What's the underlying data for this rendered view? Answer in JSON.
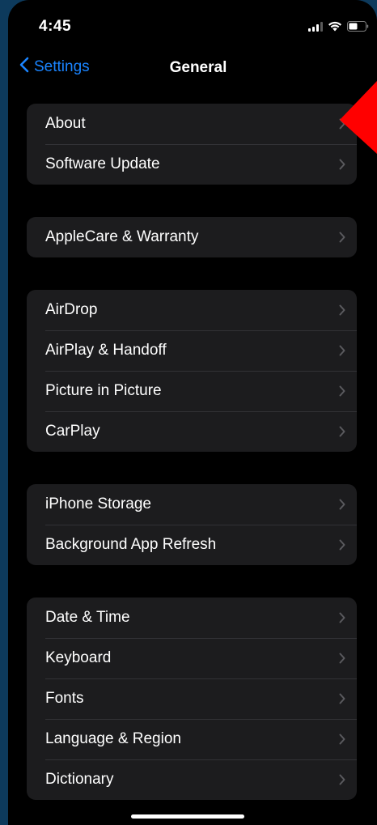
{
  "status_bar": {
    "time": "4:45"
  },
  "nav": {
    "back_label": "Settings",
    "title": "General"
  },
  "groups": [
    {
      "rows": [
        "About",
        "Software Update"
      ]
    },
    {
      "rows": [
        "AppleCare & Warranty"
      ]
    },
    {
      "rows": [
        "AirDrop",
        "AirPlay & Handoff",
        "Picture in Picture",
        "CarPlay"
      ]
    },
    {
      "rows": [
        "iPhone Storage",
        "Background App Refresh"
      ]
    },
    {
      "rows": [
        "Date & Time",
        "Keyboard",
        "Fonts",
        "Language & Region",
        "Dictionary"
      ]
    }
  ],
  "colors": {
    "background": "#000000",
    "cell": "#1c1c1e",
    "separator": "#323236",
    "accent": "#1a84ff",
    "chevron": "#5a5a5e",
    "marker": "#ff0000",
    "frame": "#0d3a5c"
  },
  "icons": {
    "back": "chevron-left-icon",
    "row_disclosure": "chevron-right-icon",
    "signal": "cellular-signal-icon",
    "wifi": "wifi-icon",
    "battery": "battery-icon",
    "marker": "red-arrow-marker"
  }
}
